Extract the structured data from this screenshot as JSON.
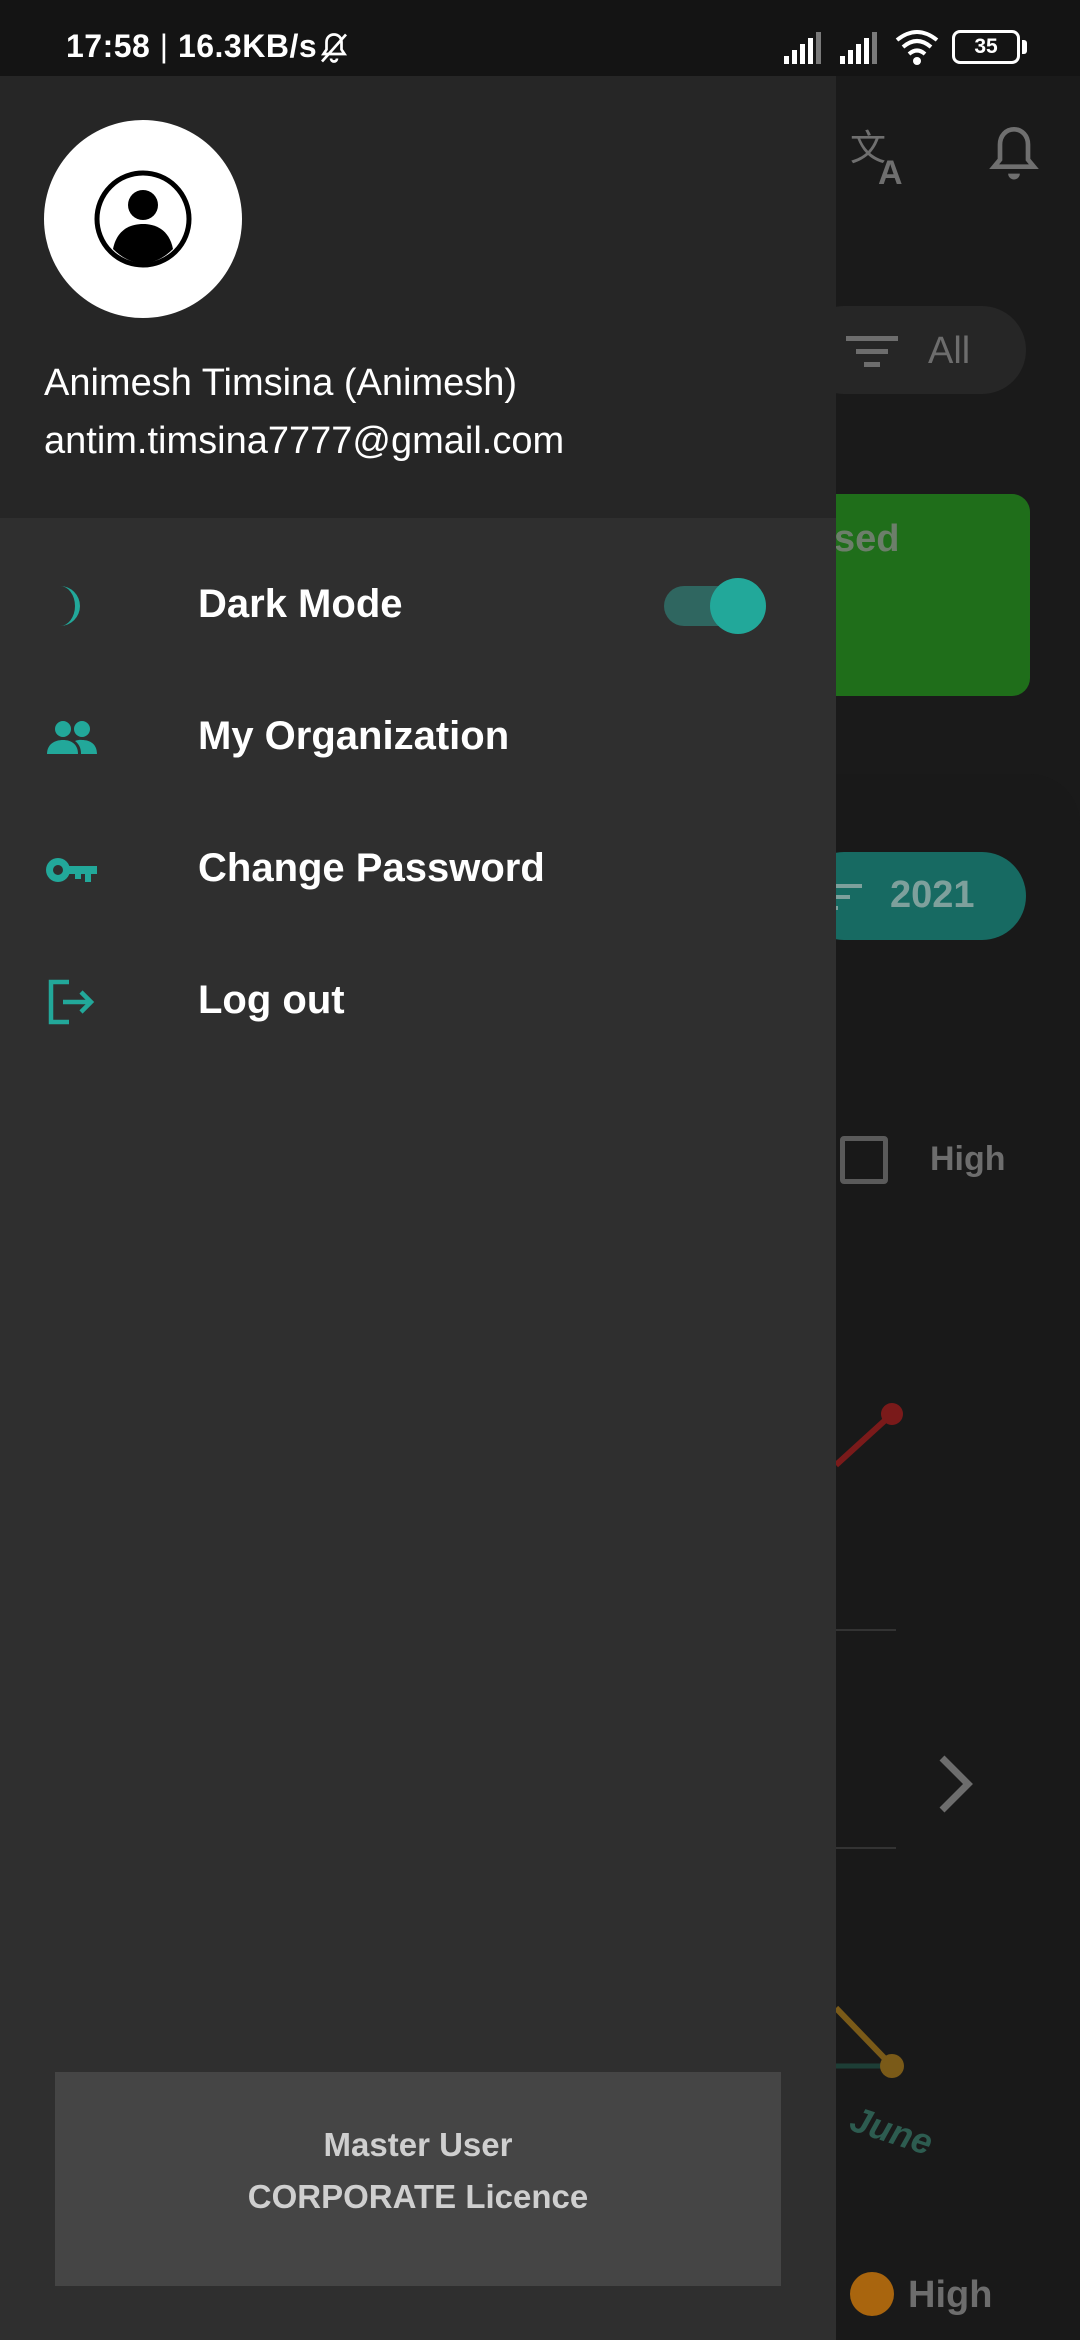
{
  "status_bar": {
    "time": "17:58",
    "separator": " | ",
    "network_speed": "16.3KB/s",
    "battery_level": "35"
  },
  "background": {
    "filter_label": "All",
    "card_text": "sed",
    "year_filter": "2021",
    "legend_high_1": "High",
    "month_label": "June",
    "legend_high_2": "High"
  },
  "drawer": {
    "user": {
      "name": "Animesh Timsina (Animesh)",
      "email": "antim.timsina7777@gmail.com"
    },
    "menu": {
      "dark_mode": {
        "label": "Dark Mode",
        "icon": "moon-icon",
        "toggle_on": true
      },
      "organization": {
        "label": "My Organization",
        "icon": "people-icon"
      },
      "password": {
        "label": "Change Password",
        "icon": "key-icon"
      },
      "logout": {
        "label": "Log out",
        "icon": "logout-icon"
      }
    },
    "licence": {
      "role": "Master User",
      "type": "CORPORATE Licence"
    }
  },
  "colors": {
    "accent": "#22a89a",
    "drawer_bg": "#2f2f2f",
    "header_bg": "#262626"
  }
}
